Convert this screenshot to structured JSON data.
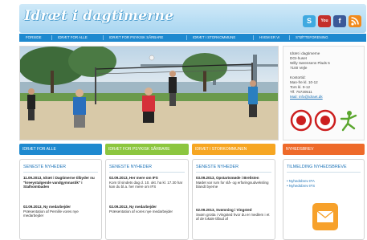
{
  "header": {
    "logo_text": "Idræt i dagtimerne",
    "social_icons": [
      {
        "name": "skype-icon",
        "color": "#3fa9e0",
        "glyph": "S"
      },
      {
        "name": "youtube-icon",
        "color": "#c4302b",
        "glyph": "You"
      },
      {
        "name": "facebook-icon",
        "color": "#3b5998",
        "glyph": "f"
      },
      {
        "name": "rss-icon",
        "color": "#f18a1c",
        "glyph": ")"
      }
    ]
  },
  "nav": {
    "items": [
      {
        "label": "FORSIDE"
      },
      {
        "label": "IDRÆT FOR ALLE"
      },
      {
        "label": "IDRÆT FOR PSYKISK SÅRBARE"
      },
      {
        "label": "IDRÆT I STORKOMMUNE"
      },
      {
        "label": "HVEM ER VI"
      },
      {
        "label": "STØTTEFORENING"
      }
    ]
  },
  "contact": {
    "lines": [
      "Idræt i dagtimerne",
      "DGI-huset",
      "Willy Sørensens Plads 5",
      "7100 Vejle",
      "",
      "Kontortid:",
      "Man-fre kl. 10-12",
      "Tors kl. 9-12",
      "Tlf. 75720511",
      "Mail: info@idraet.dk"
    ]
  },
  "sections": [
    {
      "label": "IDRÆT FOR ALLE",
      "color": "#1e89cf"
    },
    {
      "label": "IDRÆT FOR PSYKISK SÅRBARE",
      "color": "#8cc63f"
    },
    {
      "label": "IDRÆT I STORKOMMUNEN",
      "color": "#f6a623"
    },
    {
      "label": "NYHEDSBREV",
      "color": "#ee6a2a"
    }
  ],
  "columns": [
    {
      "title": "SENESTE NYHEDER",
      "news": [
        {
          "head": "11.09.2013, Idræt i Dagtimerne tilbyder nu \"kreeystalgende vandgymnastik\" i Stalhoimbaden"
        },
        {
          "head": "02.09.2013, Ny medarbejder",
          "body": "Præsentation af Pernille vores nye medarbejder"
        }
      ]
    },
    {
      "title": "SENESTE NYHEDER",
      "news": [
        {
          "head": "02.09.2013, Her mere om IFS",
          "body": "Kom til sindets dag d. 10. okt. ha kl. 17.30 har kan du bl.a. her mere om IFS"
        },
        {
          "head": "02.09.2013, Ny medarbejder",
          "body": "Præsentation af vores nye medarbejder"
        }
      ]
    },
    {
      "title": "SENESTE NYHEDER",
      "news": [
        {
          "head": "03.09.2013, Opstartsmøde i Brelisten",
          "body": "Mødet var rum for slå- og erfaringsudveksling blandt byerne"
        },
        {
          "head": "02.09.2013, Svømning i Vingsted",
          "body": "Svøm grotta i Vingsted hvor du er medlem i et af de lokale tilbud af"
        }
      ]
    },
    {
      "title": "TILMELDING NYHEDSBREVE",
      "links": [
        "• Nyhedsbrev IFA",
        "• Nyhedsbrev IFS"
      ]
    }
  ]
}
